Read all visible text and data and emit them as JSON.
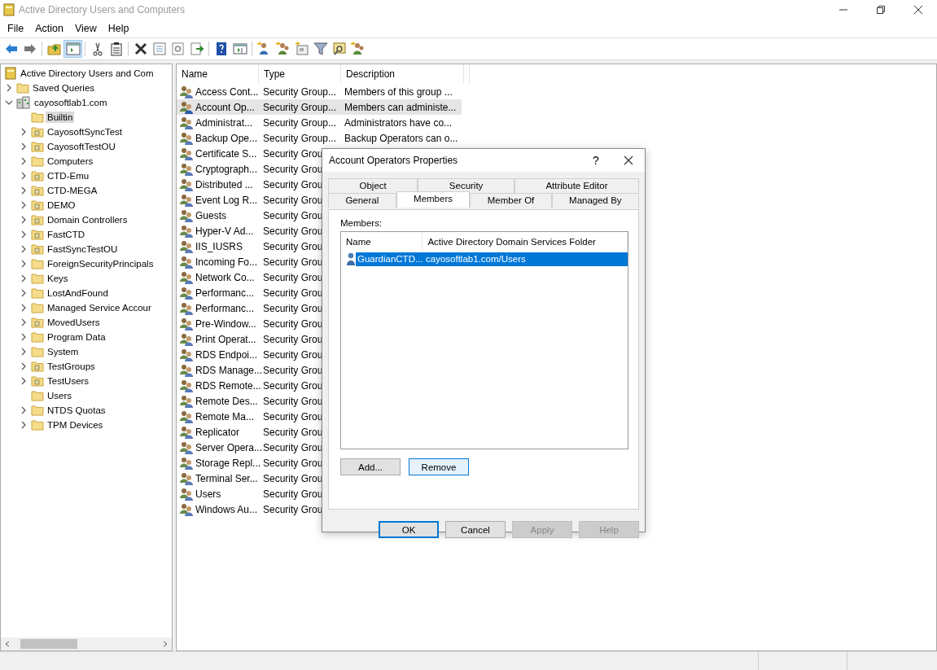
{
  "window": {
    "title": "Active Directory Users and Computers"
  },
  "menu": [
    "File",
    "Action",
    "View",
    "Help"
  ],
  "tree": [
    {
      "label": "Active Directory Users and Com",
      "kind": "root",
      "selected": false,
      "children": [
        {
          "label": "Saved Queries",
          "kind": "folder",
          "expanded": false,
          "selected": false
        },
        {
          "label": "cayosoftlab1.com",
          "kind": "domain",
          "expanded": true,
          "selected": false,
          "children": [
            {
              "label": "Builtin",
              "kind": "folder",
              "selected": true
            },
            {
              "label": "CayosoftSyncTest",
              "kind": "ou",
              "expanded": false,
              "selected": false
            },
            {
              "label": "CayosoftTestOU",
              "kind": "ou",
              "expanded": false,
              "selected": false
            },
            {
              "label": "Computers",
              "kind": "folder",
              "expanded": false,
              "selected": false
            },
            {
              "label": "CTD-Emu",
              "kind": "ou",
              "expanded": false,
              "selected": false
            },
            {
              "label": "CTD-MEGA",
              "kind": "ou",
              "expanded": false,
              "selected": false
            },
            {
              "label": "DEMO",
              "kind": "ou",
              "expanded": false,
              "selected": false
            },
            {
              "label": "Domain Controllers",
              "kind": "ou",
              "expanded": false,
              "selected": false
            },
            {
              "label": "FastCTD",
              "kind": "ou",
              "expanded": false,
              "selected": false
            },
            {
              "label": "FastSyncTestOU",
              "kind": "ou",
              "expanded": false,
              "selected": false
            },
            {
              "label": "ForeignSecurityPrincipals",
              "kind": "folder",
              "expanded": false,
              "selected": false
            },
            {
              "label": "Keys",
              "kind": "folder",
              "expanded": false,
              "selected": false
            },
            {
              "label": "LostAndFound",
              "kind": "folder",
              "expanded": false,
              "selected": false
            },
            {
              "label": "Managed Service Accour",
              "kind": "folder",
              "expanded": false,
              "selected": false
            },
            {
              "label": "MovedUsers",
              "kind": "ou",
              "expanded": false,
              "selected": false
            },
            {
              "label": "Program Data",
              "kind": "folder",
              "expanded": false,
              "selected": false
            },
            {
              "label": "System",
              "kind": "folder",
              "expanded": false,
              "selected": false
            },
            {
              "label": "TestGroups",
              "kind": "ou",
              "expanded": false,
              "selected": false
            },
            {
              "label": "TestUsers",
              "kind": "ou",
              "expanded": false,
              "selected": false
            },
            {
              "label": "Users",
              "kind": "folder",
              "selected": false
            },
            {
              "label": "NTDS Quotas",
              "kind": "folder",
              "expanded": false,
              "selected": false
            },
            {
              "label": "TPM Devices",
              "kind": "folder",
              "expanded": false,
              "selected": false
            }
          ]
        }
      ]
    }
  ],
  "list": {
    "columns": [
      "Name",
      "Type",
      "Description"
    ],
    "rows": [
      {
        "name": "Access Cont...",
        "type": "Security Group...",
        "description": "Members of this group ...",
        "selected": false
      },
      {
        "name": "Account Op...",
        "type": "Security Group...",
        "description": "Members can administe...",
        "selected": true
      },
      {
        "name": "Administrat...",
        "type": "Security Group...",
        "description": "Administrators have co...",
        "selected": false
      },
      {
        "name": "Backup Ope...",
        "type": "Security Group...",
        "description": "Backup Operators can o...",
        "selected": false
      },
      {
        "name": "Certificate S...",
        "type": "Security Grou",
        "selected": false
      },
      {
        "name": "Cryptograph...",
        "type": "Security Grou",
        "selected": false
      },
      {
        "name": "Distributed ...",
        "type": "Security Grou",
        "selected": false
      },
      {
        "name": "Event Log R...",
        "type": "Security Grou",
        "selected": false
      },
      {
        "name": "Guests",
        "type": "Security Grou",
        "selected": false
      },
      {
        "name": "Hyper-V Ad...",
        "type": "Security Grou",
        "selected": false
      },
      {
        "name": "IIS_IUSRS",
        "type": "Security Grou",
        "selected": false
      },
      {
        "name": "Incoming Fo...",
        "type": "Security Grou",
        "selected": false
      },
      {
        "name": "Network Co...",
        "type": "Security Grou",
        "selected": false
      },
      {
        "name": "Performanc...",
        "type": "Security Grou",
        "selected": false
      },
      {
        "name": "Performanc...",
        "type": "Security Grou",
        "selected": false
      },
      {
        "name": "Pre-Window...",
        "type": "Security Grou",
        "selected": false
      },
      {
        "name": "Print Operat...",
        "type": "Security Grou",
        "selected": false
      },
      {
        "name": "RDS Endpoi...",
        "type": "Security Grou",
        "selected": false
      },
      {
        "name": "RDS Manage...",
        "type": "Security Grou",
        "selected": false
      },
      {
        "name": "RDS Remote...",
        "type": "Security Grou",
        "selected": false
      },
      {
        "name": "Remote Des...",
        "type": "Security Grou",
        "selected": false
      },
      {
        "name": "Remote Ma...",
        "type": "Security Grou",
        "selected": false
      },
      {
        "name": "Replicator",
        "type": "Security Grou",
        "selected": false
      },
      {
        "name": "Server Opera...",
        "type": "Security Grou",
        "selected": false
      },
      {
        "name": "Storage Repl...",
        "type": "Security Grou",
        "selected": false
      },
      {
        "name": "Terminal Ser...",
        "type": "Security Grou",
        "selected": false
      },
      {
        "name": "Users",
        "type": "Security Grou",
        "selected": false
      },
      {
        "name": "Windows Au...",
        "type": "Security Grou",
        "selected": false
      }
    ]
  },
  "dialog": {
    "title": "Account Operators Properties",
    "help": "?",
    "tab_rows": [
      [
        {
          "label": "Object",
          "selected": false
        },
        {
          "label": "Security",
          "selected": false
        },
        {
          "label": "Attribute Editor",
          "selected": false
        }
      ],
      [
        {
          "label": "General",
          "selected": false
        },
        {
          "label": "Members",
          "selected": true
        },
        {
          "label": "Member Of",
          "selected": false
        },
        {
          "label": "Managed By",
          "selected": false
        }
      ]
    ],
    "members_label": "Members:",
    "members": {
      "columns": [
        "Name",
        "Active Directory Domain Services Folder"
      ],
      "rows": [
        {
          "name": "GuardianCTD...",
          "folder": "cayosoftlab1.com/Users",
          "selected": true
        }
      ]
    },
    "list_buttons": [
      {
        "label": "Add...",
        "focused": false
      },
      {
        "label": "Remove",
        "focused": true
      }
    ],
    "buttons": [
      {
        "label": "OK",
        "default": true,
        "disabled": false
      },
      {
        "label": "Cancel",
        "default": false,
        "disabled": false
      },
      {
        "label": "Apply",
        "default": false,
        "disabled": true
      },
      {
        "label": "Help",
        "default": false,
        "disabled": true
      }
    ]
  }
}
